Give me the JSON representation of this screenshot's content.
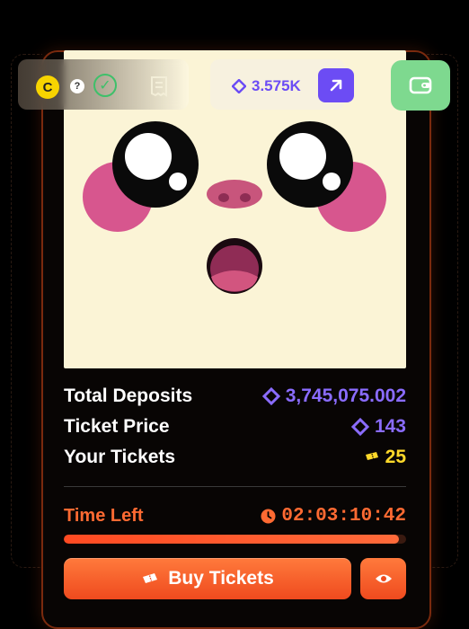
{
  "topbar": {
    "coin_symbol": "C",
    "help_symbol": "?",
    "check_symbol": "✓",
    "balance": "3.575K",
    "icons": [
      "coin-icon",
      "help-icon",
      "check-icon",
      "receipt-icon",
      "diamond-icon",
      "arrow-up-right-icon",
      "wallet-icon"
    ]
  },
  "stats": [
    {
      "label": "Total Deposits",
      "value": "3,745,075.002",
      "icon": "diamond-icon"
    },
    {
      "label": "Ticket Price",
      "value": "143",
      "icon": "diamond-icon"
    },
    {
      "label": "Your Tickets",
      "value": "25",
      "icon": "ticket-icon"
    }
  ],
  "timer": {
    "label": "Time Left",
    "value": "02:03:10:42",
    "progress_fraction": 0.98
  },
  "actions": {
    "buy_label": "Buy Tickets"
  },
  "colors": {
    "accent_orange": "#ff6a32",
    "accent_purple": "#8a6cff",
    "accent_yellow": "#ffd92a",
    "wallet_green": "#7ed98f",
    "art_background": "#fbf4d6"
  }
}
